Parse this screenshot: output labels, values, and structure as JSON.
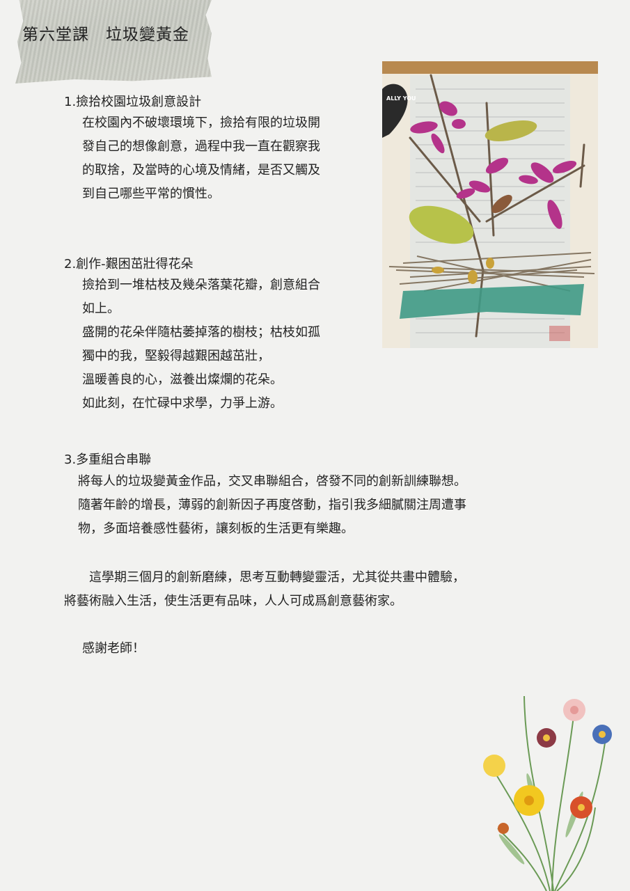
{
  "title": "第六堂課　垃圾變黃金",
  "section1": {
    "heading": "1.撿拾校園垃圾創意設計",
    "lines": [
      "在校園內不破壞環境下，撿拾有限的垃圾開",
      "發自己的想像創意，過程中我一直在觀察我",
      "的取捨，及當時的心境及情緒，是否又觸及",
      "到自己哪些平常的慣性。"
    ]
  },
  "section2": {
    "heading": "2.創作-艱困茁壯得花朵",
    "lines": [
      "撿拾到一堆枯枝及幾朵落葉花瓣，創意組合",
      "如上。",
      "盛開的花朵伴隨枯萎掉落的樹枝；枯枝如孤",
      "獨中的我，堅毅得越艱困越茁壯，",
      "溫暖善良的心，滋養出燦爛的花朵。",
      "如此刻，在忙碌中求學，力爭上游。"
    ]
  },
  "section3": {
    "heading": "3.多重組合串聯",
    "lines": [
      "將每人的垃圾變黃金作品，交叉串聯組合，啓發不同的創新訓練聯想。",
      "隨著年齡的增長，薄弱的創新因子再度啓動，指引我多細膩關注周遭事",
      "物，多面培養感性藝術，讓刻板的生活更有樂趣。"
    ]
  },
  "closing": {
    "lines": [
      "　　這學期三個月的創新磨練，思考互動轉變靈活，尤其從共畫中體驗，",
      "將藝術融入生活，使生活更有品味，人人可成爲創意藝術家。"
    ],
    "thanks": "感謝老師！"
  },
  "photo": {
    "sticker_text": "ALLY YOU",
    "colors": {
      "flower": "#b4338a",
      "leaf": "#b9b54a",
      "green_base": "#3f9a86",
      "wood": "#b8894f"
    }
  }
}
